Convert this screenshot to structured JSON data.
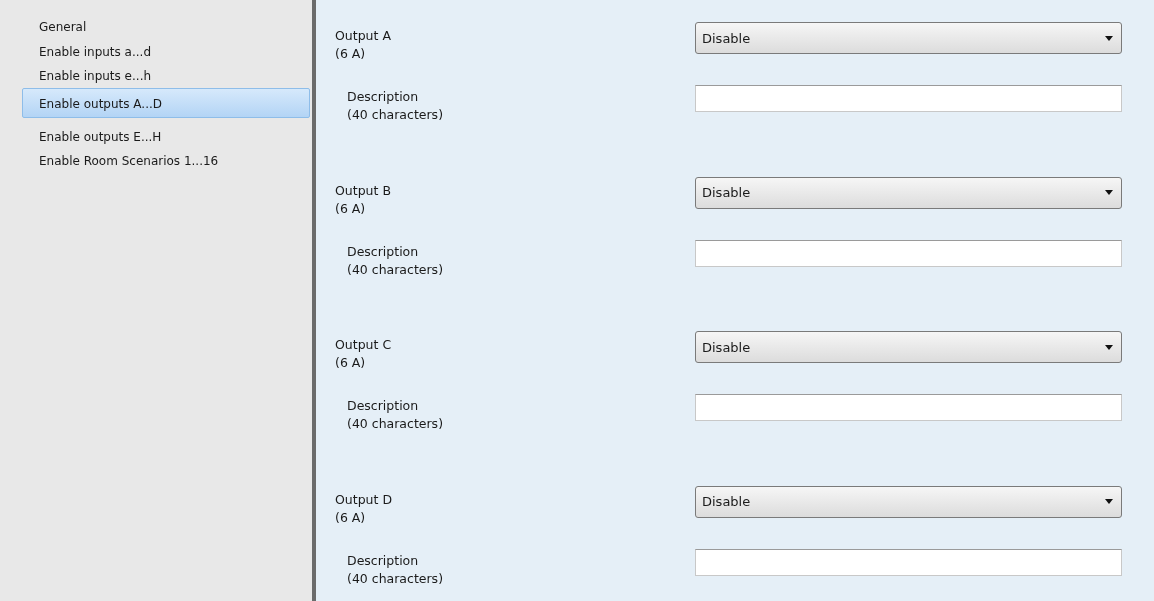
{
  "sidebar": {
    "items": [
      {
        "label": "General",
        "selected": false
      },
      {
        "label": "Enable inputs a...d",
        "selected": false
      },
      {
        "label": "Enable inputs e...h",
        "selected": false
      },
      {
        "label": "Enable outputs A...D",
        "selected": true
      },
      {
        "label": "Enable outputs E...H",
        "selected": false
      },
      {
        "label": "Enable Room Scenarios 1...16",
        "selected": false
      }
    ]
  },
  "outputs": [
    {
      "name": "Output A",
      "rating": "(6 A)",
      "value": "Disable",
      "description_label": "Description",
      "description_hint": "(40 characters)"
    },
    {
      "name": "Output B",
      "rating": "(6 A)",
      "value": "Disable",
      "description_label": "Description",
      "description_hint": "(40 characters)"
    },
    {
      "name": "Output C",
      "rating": "(6 A)",
      "value": "Disable",
      "description_label": "Description",
      "description_hint": "(40 characters)"
    },
    {
      "name": "Output D",
      "rating": "(6 A)",
      "value": "Disable",
      "description_label": "Description",
      "description_hint": "(40 characters)"
    }
  ]
}
